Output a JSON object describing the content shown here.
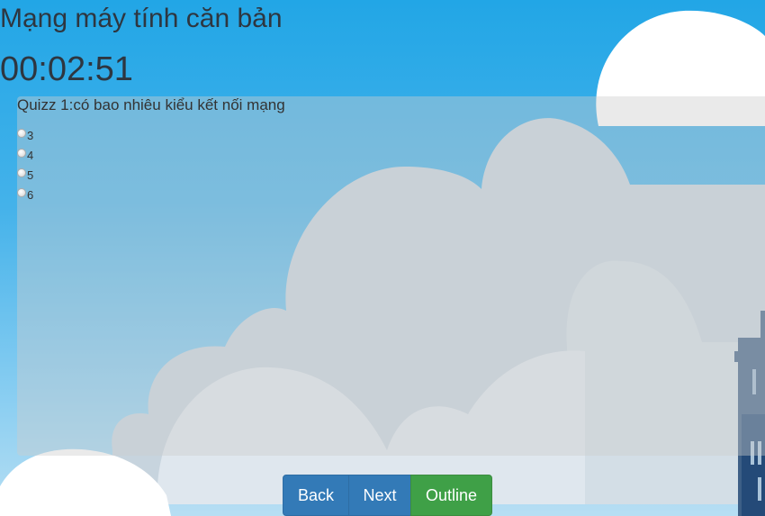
{
  "course": {
    "title": "Mạng máy tính căn bản"
  },
  "timer": {
    "value": "00:02:51"
  },
  "quiz": {
    "question": "Quizz 1:có bao nhiêu kiểu kết nối mạng",
    "options": [
      "3",
      "4",
      "5",
      "6"
    ]
  },
  "buttons": {
    "back": "Back",
    "next": "Next",
    "outline": "Outline"
  },
  "colors": {
    "sky_top": "#22a6e6",
    "primary_button": "#337ab7",
    "success_button": "#3fa047",
    "text": "#2e3640"
  }
}
